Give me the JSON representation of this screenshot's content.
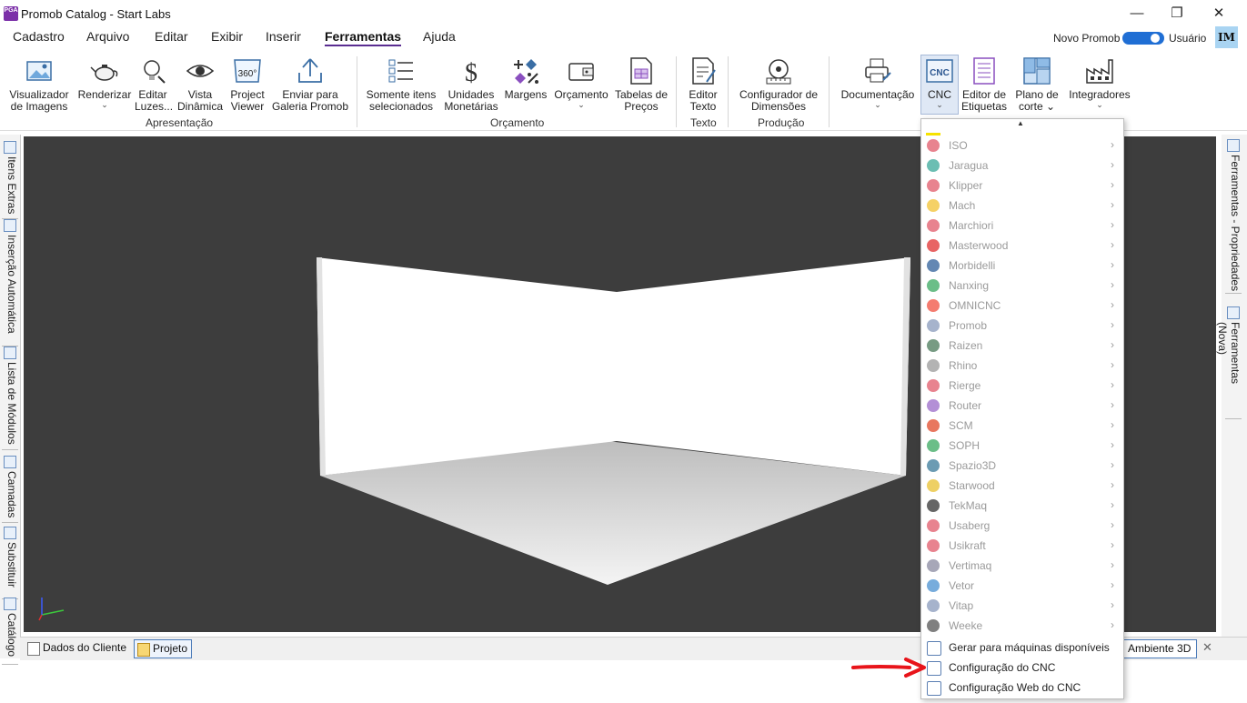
{
  "window": {
    "title": "Promob Catalog - Start Labs",
    "logo_text": "PGA",
    "minimize": "—",
    "maximize": "❐",
    "close": "✕"
  },
  "menu": {
    "items": [
      "Cadastro",
      "Arquivo",
      "Editar",
      "Exibir",
      "Inserir",
      "Ferramentas",
      "Ajuda"
    ],
    "active": "Ferramentas",
    "novo_promob": "Novo Promob",
    "usuario": "Usuário",
    "avatar": "IM"
  },
  "ribbon": {
    "buttons": [
      {
        "l1": "Visualizador",
        "l2": "de Imagens"
      },
      {
        "l1": "Renderizar",
        "l2": "⌄"
      },
      {
        "l1": "Editar",
        "l2": "Luzes..."
      },
      {
        "l1": "Vista",
        "l2": "Dinâmica"
      },
      {
        "l1": "Project",
        "l2": "Viewer",
        "icon_text": "360°"
      },
      {
        "l1": "Enviar para",
        "l2": "Galeria Promob"
      },
      {
        "l1": "Somente itens",
        "l2": "selecionados"
      },
      {
        "l1": "Unidades",
        "l2": "Monetárias"
      },
      {
        "l1": "Margens",
        "l2": ""
      },
      {
        "l1": "Orçamento",
        "l2": "⌄"
      },
      {
        "l1": "Tabelas de",
        "l2": "Preços"
      },
      {
        "l1": "Editor",
        "l2": "Texto"
      },
      {
        "l1": "Configurador de",
        "l2": "Dimensões"
      },
      {
        "l1": "Documentação",
        "l2": "⌄"
      },
      {
        "l1": "CNC",
        "l2": "⌄",
        "icon_text": "CNC"
      },
      {
        "l1": "Editor de",
        "l2": "Etiquetas"
      },
      {
        "l1": "Plano de",
        "l2": "corte ⌄"
      },
      {
        "l1": "Integradores",
        "l2": "⌄"
      }
    ],
    "groups": [
      "Apresentação",
      "Orçamento",
      "Texto",
      "Produção"
    ]
  },
  "left_tabs": [
    "Itens Extras",
    "Inserção Automática",
    "Lista de Módulos",
    "Camadas",
    "Substituir",
    "Catálogo"
  ],
  "right_tabs": [
    "Ferramentas - Propriedades",
    "Ferramentas (Nova)"
  ],
  "bottom_tabs": {
    "dados": "Dados do Cliente",
    "projeto": "Projeto",
    "ambiente": "Ambiente 3D",
    "close": "✕"
  },
  "dropdown": {
    "caret": "▲",
    "submenu_arrow": "›",
    "items": [
      {
        "label": "ISO",
        "color": "#e05a6a"
      },
      {
        "label": "Jaragua",
        "color": "#3aa89a"
      },
      {
        "label": "Klipper",
        "color": "#e05a6a"
      },
      {
        "label": "Mach",
        "color": "#f1c232"
      },
      {
        "label": "Marchiori",
        "color": "#e05a6a"
      },
      {
        "label": "Masterwood",
        "color": "#e03030"
      },
      {
        "label": "Morbidelli",
        "color": "#2f5f9a"
      },
      {
        "label": "Nanxing",
        "color": "#3aa860"
      },
      {
        "label": "OMNICNC",
        "color": "#f05040"
      },
      {
        "label": "Promob",
        "color": "#8899bb"
      },
      {
        "label": "Raizen",
        "color": "#4a7a5a"
      },
      {
        "label": "Rhino",
        "color": "#999999"
      },
      {
        "label": "Rierge",
        "color": "#e05a6a"
      },
      {
        "label": "Router",
        "color": "#9a6ac8"
      },
      {
        "label": "SCM",
        "color": "#e04a2a"
      },
      {
        "label": "SOPH",
        "color": "#3aa860"
      },
      {
        "label": "Spazio3D",
        "color": "#3a7a9a"
      },
      {
        "label": "Starwood",
        "color": "#e8c030"
      },
      {
        "label": "TekMaq",
        "color": "#333333"
      },
      {
        "label": "Usaberg",
        "color": "#e05a6a"
      },
      {
        "label": "Usikraft",
        "color": "#e05a6a"
      },
      {
        "label": "Vertimaq",
        "color": "#8a8aa0"
      },
      {
        "label": "Vetor",
        "color": "#4a90d0"
      },
      {
        "label": "Vitap",
        "color": "#8899bb"
      },
      {
        "label": "Weeke",
        "color": "#555555"
      }
    ],
    "actions": [
      {
        "label": "Gerar para máquinas disponíveis"
      },
      {
        "label": "Configuração do CNC"
      },
      {
        "label": "Configuração Web do CNC"
      }
    ]
  },
  "colors": {
    "accent": "#5a2d91",
    "viewport_bg": "#3d3d3d",
    "toggle": "#1f6ed4",
    "annotation_arrow": "#e8141a"
  }
}
